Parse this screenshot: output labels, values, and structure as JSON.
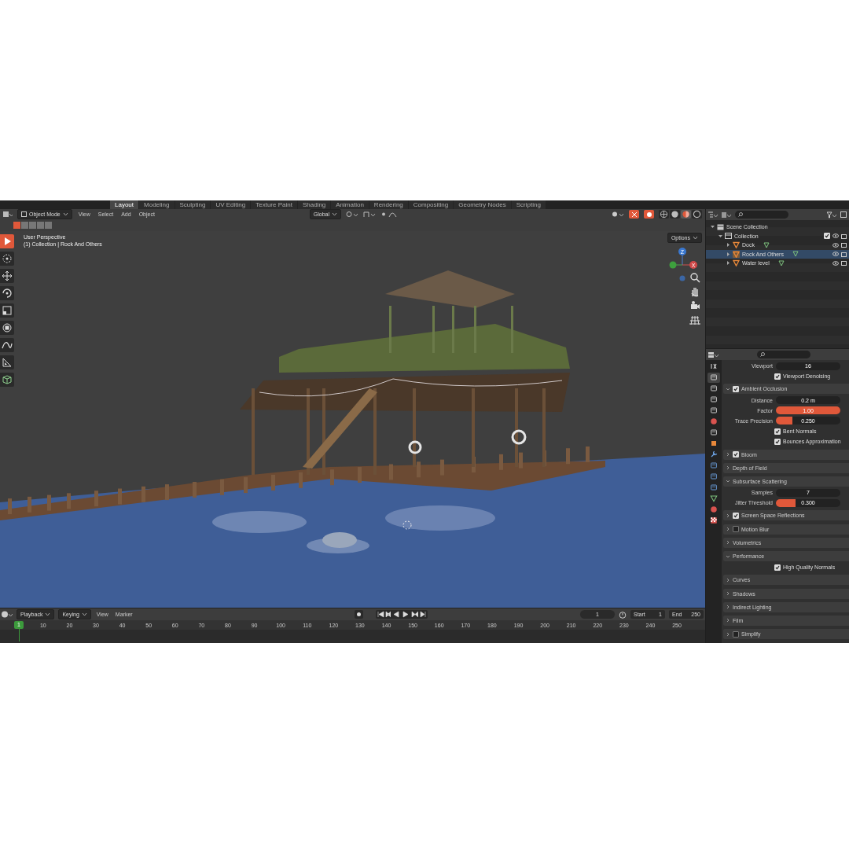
{
  "workspace_tabs": [
    {
      "label": "Layout",
      "selected": true
    },
    {
      "label": "Modeling",
      "selected": false
    },
    {
      "label": "Sculpting",
      "selected": false
    },
    {
      "label": "UV Editing",
      "selected": false
    },
    {
      "label": "Texture Paint",
      "selected": false
    },
    {
      "label": "Shading",
      "selected": false
    },
    {
      "label": "Animation",
      "selected": false
    },
    {
      "label": "Rendering",
      "selected": false
    },
    {
      "label": "Compositing",
      "selected": false
    },
    {
      "label": "Geometry Nodes",
      "selected": false
    },
    {
      "label": "Scripting",
      "selected": false
    }
  ],
  "header": {
    "mode": "Object Mode",
    "menus": [
      "View",
      "Select",
      "Add",
      "Object"
    ],
    "orientation": "Global",
    "shading_modes": [
      {
        "kind": "wireframe",
        "selected": false
      },
      {
        "kind": "solid",
        "selected": false
      },
      {
        "kind": "material",
        "selected": true
      },
      {
        "kind": "rendered",
        "selected": false
      }
    ]
  },
  "viewport": {
    "overlay_lines": [
      "User Perspective",
      "(1) Collection | Rock And Others"
    ],
    "options": "Options",
    "axes": [
      "Z",
      "X"
    ],
    "tools": [
      {
        "kind": "select",
        "selected": true
      },
      {
        "kind": "cursor",
        "selected": false
      },
      {
        "kind": "move",
        "selected": false
      },
      {
        "kind": "rotate",
        "selected": false
      },
      {
        "kind": "scale",
        "selected": false
      },
      {
        "kind": "transform",
        "selected": false
      },
      {
        "kind": "annotate",
        "selected": false
      },
      {
        "kind": "measure",
        "selected": false
      },
      {
        "kind": "add-cube",
        "selected": false
      }
    ]
  },
  "outliner": {
    "items": [
      {
        "label": "Scene Collection",
        "kind": "scene",
        "children": [
          {
            "label": "Collection",
            "kind": "collection",
            "expanded": true,
            "checked": true,
            "children": [
              {
                "label": "Dock",
                "kind": "object",
                "selected": false,
                "expanded": false
              },
              {
                "label": "Rock And Others",
                "kind": "object",
                "selected": true,
                "expanded": false
              },
              {
                "label": "Water level",
                "kind": "object",
                "selected": false,
                "expanded": false
              }
            ]
          }
        ]
      }
    ]
  },
  "properties": {
    "tabs": [
      {
        "kind": "tool",
        "selected": false
      },
      {
        "kind": "render",
        "selected": true
      },
      {
        "kind": "output",
        "selected": false
      },
      {
        "kind": "view-layer",
        "selected": false
      },
      {
        "kind": "scene",
        "selected": false
      },
      {
        "kind": "world",
        "selected": false
      },
      {
        "kind": "collection",
        "selected": false
      },
      {
        "kind": "object",
        "selected": false
      },
      {
        "kind": "modifier",
        "selected": false
      },
      {
        "kind": "particles",
        "selected": false
      },
      {
        "kind": "physics",
        "selected": false
      },
      {
        "kind": "constraints",
        "selected": false
      },
      {
        "kind": "data",
        "selected": false
      },
      {
        "kind": "material",
        "selected": false
      },
      {
        "kind": "texture",
        "selected": false
      }
    ],
    "rows": [
      {
        "kind": "field",
        "label": "Viewport",
        "value": "16"
      },
      {
        "kind": "checkbox",
        "label": "Viewport Denoising",
        "checked": true
      },
      {
        "kind": "panel",
        "label": "Ambient Occlusion",
        "expanded": true,
        "checked": true
      },
      {
        "kind": "field",
        "label": "Distance",
        "value": "0.2 m"
      },
      {
        "kind": "field",
        "label": "Factor",
        "value": "1.00",
        "level": 1
      },
      {
        "kind": "field",
        "label": "Trace Precision",
        "value": "0.250",
        "level": 0.25
      },
      {
        "kind": "checkbox",
        "label": "Bent Normals",
        "checked": true
      },
      {
        "kind": "checkbox",
        "label": "Bounces Approximation",
        "checked": true
      },
      {
        "kind": "panel",
        "label": "Bloom",
        "expanded": false,
        "checked": true
      },
      {
        "kind": "panel",
        "label": "Depth of Field",
        "expanded": false
      },
      {
        "kind": "panel",
        "label": "Subsurface Scattering",
        "expanded": true
      },
      {
        "kind": "field",
        "label": "Samples",
        "value": "7"
      },
      {
        "kind": "field",
        "label": "Jitter Threshold",
        "value": "0.300",
        "level": 0.3
      },
      {
        "kind": "panel",
        "label": "Screen Space Reflections",
        "expanded": false,
        "checked": true
      },
      {
        "kind": "panel",
        "label": "Motion Blur",
        "expanded": false,
        "checked": false
      },
      {
        "kind": "panel",
        "label": "Volumetrics",
        "expanded": false
      },
      {
        "kind": "panel",
        "label": "Performance",
        "expanded": true
      },
      {
        "kind": "checkbox",
        "label": "High Quality Normals",
        "checked": true
      },
      {
        "kind": "panel",
        "label": "Curves",
        "expanded": false
      },
      {
        "kind": "panel",
        "label": "Shadows",
        "expanded": false
      },
      {
        "kind": "panel",
        "label": "Indirect Lighting",
        "expanded": false
      },
      {
        "kind": "panel",
        "label": "Film",
        "expanded": false
      },
      {
        "kind": "panel",
        "label": "Simplify",
        "expanded": false,
        "checked": false
      }
    ]
  },
  "timeline": {
    "menus": [
      "Playback",
      "Keying",
      "View",
      "Marker"
    ],
    "current_frame": "1",
    "start_label": "Start",
    "start": "1",
    "end_label": "End",
    "end": "250",
    "playhead": "1",
    "ticks": [
      "10",
      "20",
      "30",
      "40",
      "50",
      "60",
      "70",
      "80",
      "90",
      "100",
      "110",
      "120",
      "130",
      "140",
      "150",
      "160",
      "170",
      "180",
      "190",
      "200",
      "210",
      "220",
      "230",
      "240",
      "250"
    ]
  }
}
